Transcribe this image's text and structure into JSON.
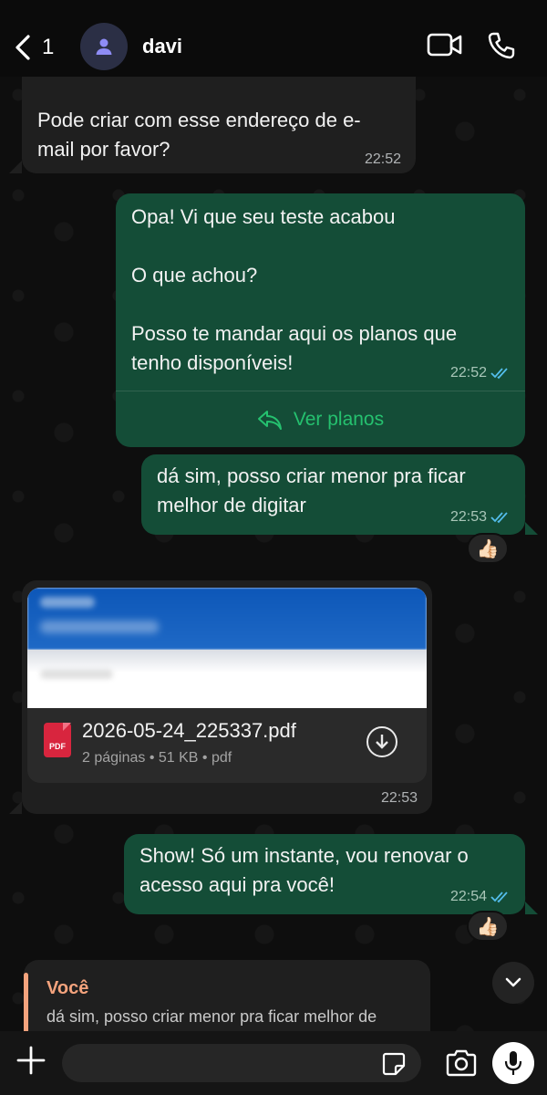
{
  "header": {
    "back_count": "1",
    "contact_name": "davi",
    "colors": {
      "background": "#0b0b0b",
      "avatar_bg": "#2b2f45",
      "avatar_icon": "#8e8cf5"
    }
  },
  "messages": [
    {
      "direction": "in",
      "text": "Pode criar com esse endereço de e-\nmail por favor?",
      "time": "22:52"
    },
    {
      "direction": "out",
      "text": "Opa! Vi que seu teste acabou\n\nO que achou?\n\nPosso te mandar aqui os planos que\ntenho disponíveis!",
      "time": "22:52",
      "button_label": "Ver planos",
      "read": true
    },
    {
      "direction": "out",
      "text": "dá sim, posso criar menor pra ficar\nmelhor de digitar",
      "time": "22:53",
      "read": true,
      "reaction": "👍🏻"
    },
    {
      "direction": "in",
      "type": "document",
      "file_name": "2026-05-24_225337.pdf",
      "meta": "2 páginas • 51 KB • pdf",
      "icon_label": "PDF",
      "time": "22:53"
    },
    {
      "direction": "out",
      "text": "Show! Só um instante, vou renovar o\nacesso aqui pra você!",
      "time": "22:54",
      "read": true,
      "reaction": "👍🏻"
    }
  ],
  "reply_preview": {
    "author": "Você",
    "text": "dá sim, posso criar menor pra ficar melhor de"
  },
  "input": {
    "placeholder": ""
  },
  "colors": {
    "incoming_bubble": "#1f1f1f",
    "outgoing_bubble": "#144d37",
    "accent_green": "#25c16f",
    "read_ticks": "#53bdeb",
    "reply_accent": "#f4a37d",
    "pdf_red": "#d8253e"
  }
}
